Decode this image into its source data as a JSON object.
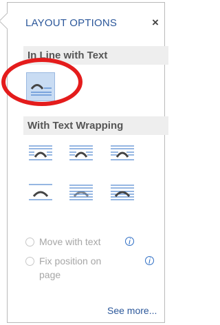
{
  "panel": {
    "title": "LAYOUT OPTIONS",
    "close_label": "×",
    "sections": {
      "inline": "In Line with Text",
      "wrapping": "With Text Wrapping"
    },
    "options": {
      "move_with_text": "Move with text",
      "fix_position": "Fix position on",
      "fix_position_2": "page"
    },
    "info_glyph": "i",
    "see_more": "See more..."
  },
  "colors": {
    "accent": "#2b579a",
    "selected": "#c9dcf3",
    "annotation": "#e41c1c"
  }
}
